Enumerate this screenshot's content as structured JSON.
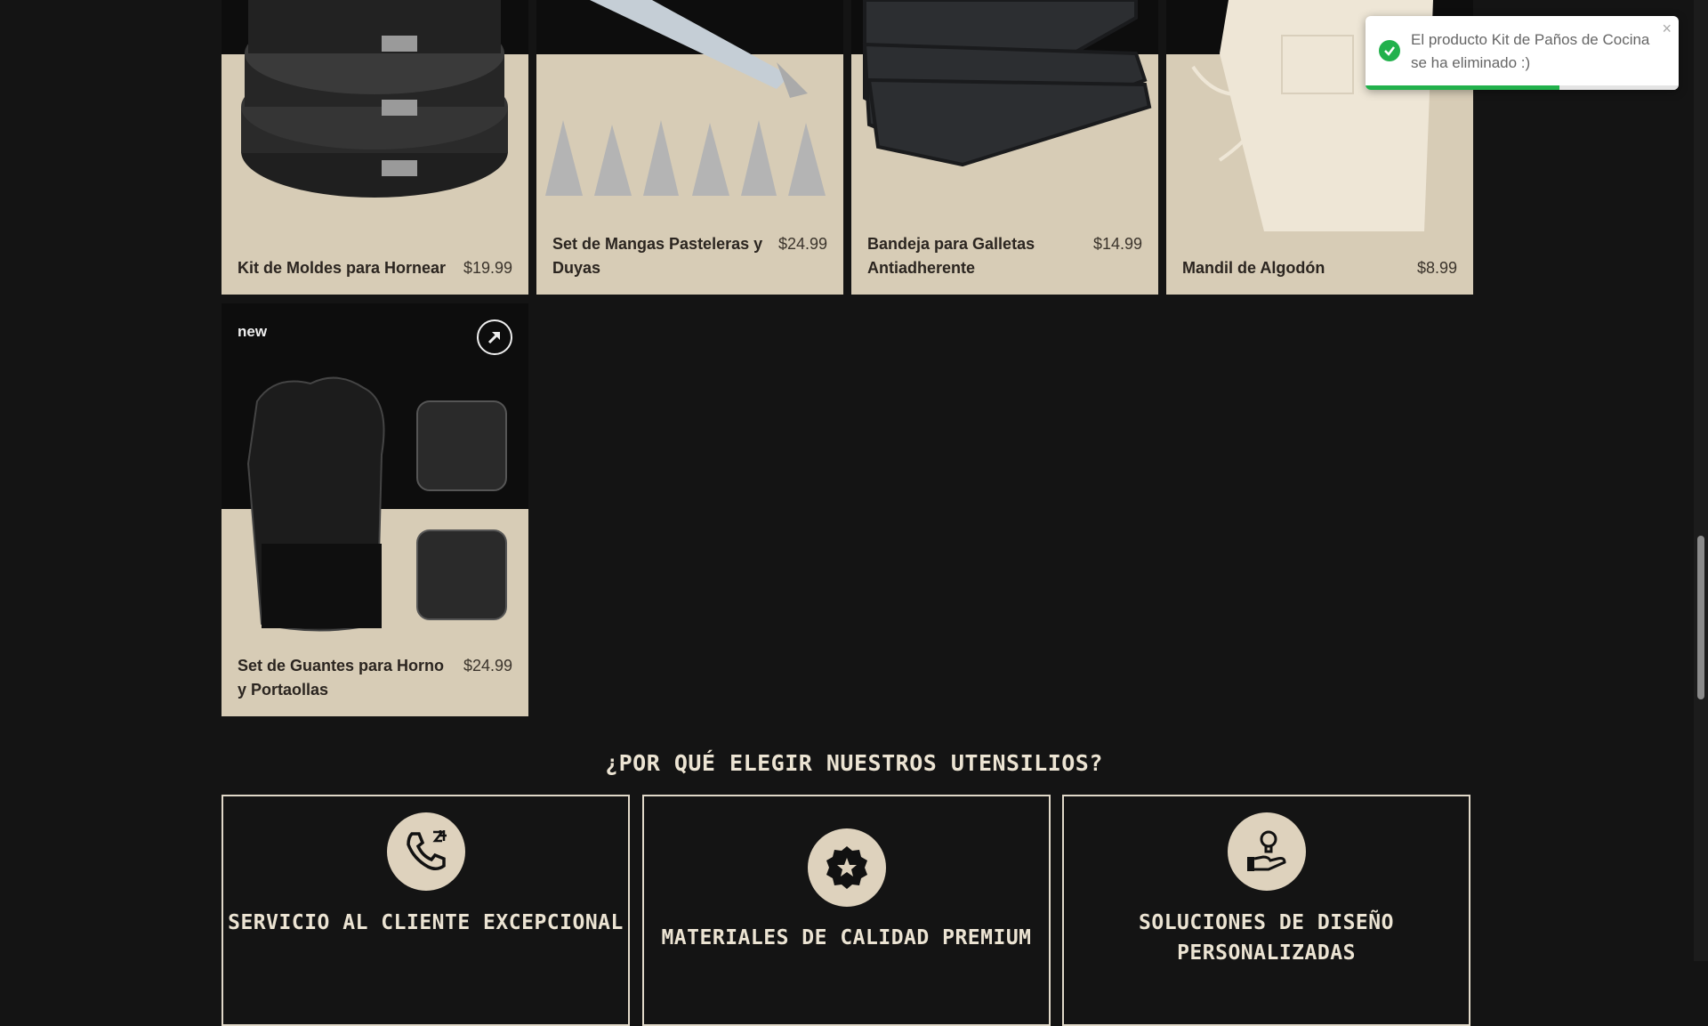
{
  "products": [
    {
      "name": "Kit de Moldes para Hornear",
      "price": "$19.99"
    },
    {
      "name": "Set de Mangas Pasteleras y Duyas",
      "price": "$24.99"
    },
    {
      "name": "Bandeja para Galletas Antiadherente",
      "price": "$14.99"
    },
    {
      "name": "Mandil de Algodón",
      "price": "$8.99"
    },
    {
      "name": "Set de Guantes para Horno y Portaollas",
      "price": "$24.99",
      "badge": "new"
    }
  ],
  "section": {
    "title": "¿POR QUÉ ELEGIR NUESTROS UTENSILIOS?",
    "features": [
      {
        "title": "SERVICIO AL CLIENTE EXCEPCIONAL",
        "icon": "phone-24h-icon"
      },
      {
        "title": "MATERIALES DE CALIDAD PREMIUM",
        "icon": "award-star-icon"
      },
      {
        "title": "SOLUCIONES DE DISEÑO PERSONALIZADAS",
        "icon": "idea-hand-icon"
      }
    ]
  },
  "toast": {
    "message": "El producto Kit de Paños de Cocina se ha eliminado :)",
    "close": "×",
    "progress": 0.62
  },
  "colors": {
    "background": "#141414",
    "card": "#d7ccb6",
    "accent": "#22b14c"
  }
}
